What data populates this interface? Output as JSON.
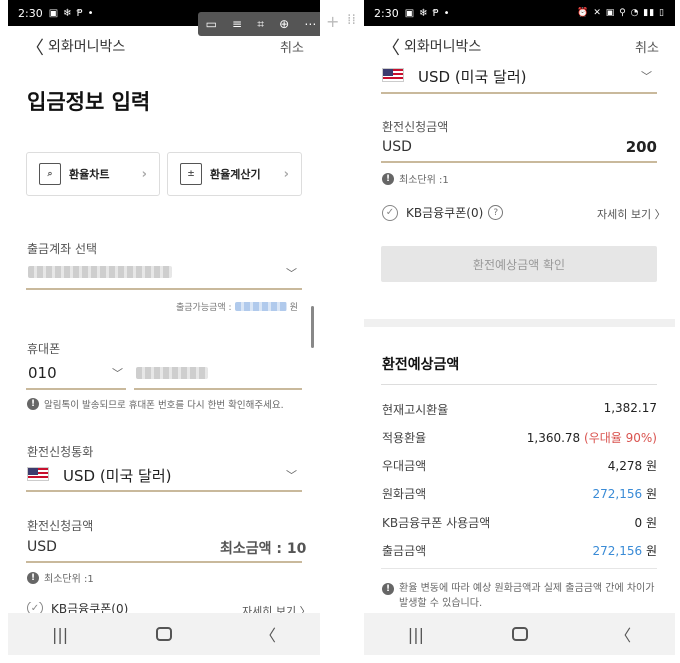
{
  "left": {
    "status": {
      "time": "2:30"
    },
    "header": {
      "back": "〈",
      "title": "외화머니박스",
      "cancel": "취소"
    },
    "page_title": "입금정보 입력",
    "tools": {
      "rate_chart": "환율차트",
      "rate_calc": "환율계산기"
    },
    "account": {
      "label": "출금계좌 선택",
      "available_label": "출금가능금액 :",
      "available_unit": "원"
    },
    "phone": {
      "label": "휴대폰",
      "prefix": "010",
      "notice": "알림톡이 발송되므로 휴대폰 번호를 다시 한번 확인해주세요."
    },
    "currency": {
      "label": "환전신청통화",
      "value": "USD (미국 달러)"
    },
    "amount": {
      "label": "환전신청금액",
      "currency": "USD",
      "min": "최소금액 : 10",
      "unit_note": "최소단위 :1"
    },
    "coupon": {
      "label": "KB금융쿠폰(0)",
      "detail": "자세히 보기 〉"
    }
  },
  "right": {
    "status": {
      "time": "2:30"
    },
    "header": {
      "back": "〈",
      "title": "외화머니박스",
      "cancel": "취소"
    },
    "currency": {
      "value": "USD (미국 달러)"
    },
    "amount": {
      "label": "환전신청금액",
      "currency": "USD",
      "value": "200",
      "unit_note": "최소단위 :1"
    },
    "coupon": {
      "label": "KB금융쿠폰(0)",
      "detail": "자세히 보기 〉"
    },
    "confirm_button": "환전예상금액 확인",
    "estimate": {
      "title": "환전예상금액",
      "rows": [
        {
          "label": "현재고시환율",
          "value": "1,382.17"
        },
        {
          "label": "적용환율",
          "value": "1,360.78",
          "extra": "(우대율 90%)"
        },
        {
          "label": "우대금액",
          "value": "4,278 원"
        },
        {
          "label": "원화금액",
          "value": "272,156",
          "unit": "원"
        },
        {
          "label": "KB금융쿠폰 사용금액",
          "value": "0 원"
        },
        {
          "label": "출금금액",
          "value": "272,156",
          "unit": "원"
        }
      ],
      "notice": "환율 변동에 따라 예상 원화금액과 실제 출금금액 간에 차이가 발생할 수 있습니다."
    }
  },
  "colors": {
    "accent_line": "#c9b99c",
    "blue": "#3a8bd6",
    "red": "#d9534f"
  }
}
